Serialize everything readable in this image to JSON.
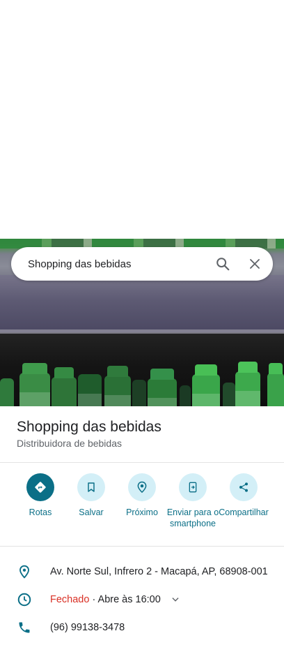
{
  "search": {
    "query": "Shopping das bebidas"
  },
  "place": {
    "name": "Shopping das bebidas",
    "category": "Distribuidora de bebidas"
  },
  "actions": [
    {
      "label": "Rotas",
      "icon": "directions-icon"
    },
    {
      "label": "Salvar",
      "icon": "bookmark-icon"
    },
    {
      "label": "Próximo",
      "icon": "nearby-icon"
    },
    {
      "label": "Enviar para o smartphone",
      "icon": "send-to-phone-icon"
    },
    {
      "label": "Compartilhar",
      "icon": "share-icon"
    }
  ],
  "details": {
    "address": "Av. Norte Sul, Infrero 2 - Macapá, AP, 68908-001",
    "status": "Fechado",
    "hours": " · Abre às 16:00",
    "phone": "(96) 99138-3478"
  },
  "colors": {
    "accent": "#0b6f87",
    "accent_light": "#d3eff7",
    "closed": "#d93025"
  }
}
